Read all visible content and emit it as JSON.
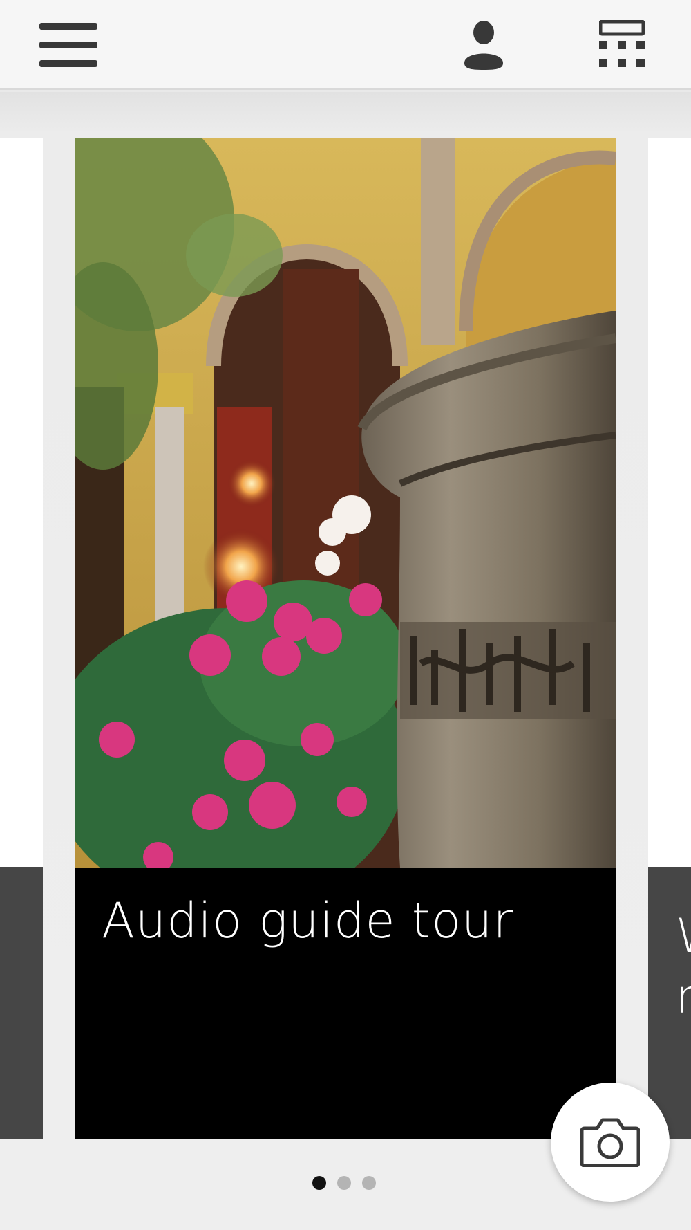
{
  "header": {
    "menu_icon": "hamburger-menu-icon",
    "profile_icon": "user-icon",
    "keypad_icon": "keypad-icon"
  },
  "carousel": {
    "current_card": {
      "title": "Audio guide tour",
      "image": "courtyard-photo"
    },
    "next_card_peek": "W\nn",
    "pager": {
      "count": 3,
      "active": 1
    }
  },
  "fab": {
    "icon": "camera-icon"
  },
  "colors": {
    "topbar": "#f6f6f6",
    "caption_bg": "#000000",
    "side_dark": "#464646",
    "dot_active": "#111111",
    "dot_inactive": "#b4b4b4"
  }
}
